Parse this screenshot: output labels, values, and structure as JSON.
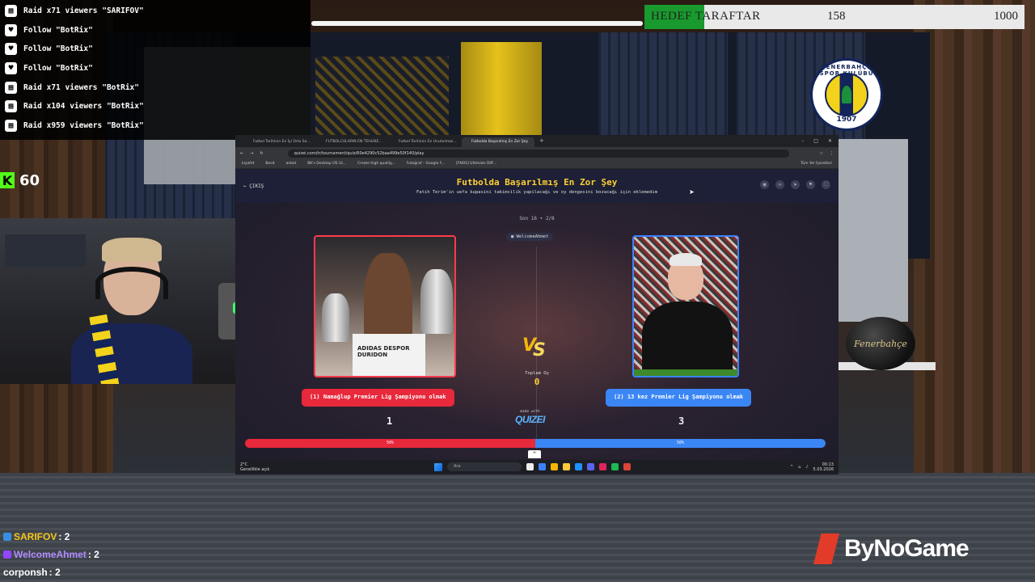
{
  "events": [
    {
      "icon": "raid-icon",
      "text": "Raid x71 viewers \"SARIFOV\""
    },
    {
      "icon": "heart-icon",
      "text": "Follow \"BotRix\""
    },
    {
      "icon": "heart-icon",
      "text": "Follow \"BotRix\""
    },
    {
      "icon": "heart-icon",
      "text": "Follow \"BotRix\""
    },
    {
      "icon": "raid-icon",
      "text": "Raid x71 viewers \"BotRix\""
    },
    {
      "icon": "raid-icon",
      "text": "Raid x104 viewers \"BotRix\""
    },
    {
      "icon": "raid-icon",
      "text": "Raid x959 viewers \"BotRix\""
    }
  ],
  "kick": {
    "logo": "K",
    "viewers": "60",
    "color": "#53fc18"
  },
  "goal": {
    "label": "HEDEF TARAFTAR",
    "current": "158",
    "target": "1000",
    "progress": 0.158,
    "fill_color": "#189a2e"
  },
  "club_badge": {
    "ring_text": "FENERBAHÇE SPOR KULÜBÜ",
    "year": "1907"
  },
  "ball_text": "Fenerbahçe",
  "chat": [
    {
      "name": "SARIFOV",
      "message": ": 2",
      "name_color": "#f5c518",
      "badge_color": "#3a8dde"
    },
    {
      "name": "WelcomeAhmet",
      "message": ": 2",
      "name_color": "#b18cff",
      "badge_color": "#9146ff"
    },
    {
      "name": "corponsh",
      "message": ": 2",
      "name_color": "#ffffff",
      "badge_color": ""
    }
  ],
  "brand": {
    "name": "ByNoGame",
    "color": "#e23b2a"
  },
  "browser": {
    "tabs": [
      {
        "label": "Futbol Tarihinin En İyi Orta Saha...",
        "active": false
      },
      {
        "label": "FUTBOLCULARIN EN TEHLİKELİ...",
        "active": false
      },
      {
        "label": "Futbol Tarihinin En Unutulmaz...",
        "active": false
      },
      {
        "label": "Futbolda Başarılmış En Zor Şey",
        "active": true
      }
    ],
    "url": "quizei.com/tr/tournament/quiz/60e4290c52baa499e50f140/play",
    "bookmarks": [
      "kiyafet",
      "Besit",
      "anket",
      "BK's Desktop OS UI...",
      "Create high quality...",
      "Fotoğraf – Google F...",
      "[FNOS] Ultimate Diff..."
    ],
    "bookmarks_right": "Tüm Yer İşaretleri"
  },
  "quiz": {
    "back_label": "ÇIKIŞ",
    "title": "Futbolda Başarılmış En Zor Şey",
    "subtitle": "Fatih Terim'in uefa kupasini takimcilik yapilacağı ve oy dengesini bozacağı için eklemedim",
    "round": "Son 16 • 2/8",
    "user": "WelcomeAhmet",
    "vs_label": "VS",
    "total_label": "Toplam Oy",
    "total_votes": "0",
    "options": [
      {
        "label": "(1) Namağlup Premier Lig Şampiyonu olmak",
        "votes": "1",
        "percent": "50%",
        "share": 0.5,
        "color": "#e8283b"
      },
      {
        "label": "(2) 13 kez Premier Lig Şampiyonu olmak",
        "votes": "3",
        "percent": "50%",
        "share": 0.5,
        "color": "#3b86f5"
      }
    ],
    "left_shorts_text": "ADIDAS DESPOR DURIDON",
    "made_with_label": "made with",
    "made_with_logo": "QUIZEI"
  },
  "taskbar": {
    "weather_temp": "2°C",
    "weather_text": "Genellikle açık",
    "search_placeholder": "Ara",
    "time": "00:13",
    "date": "5.03.2026"
  }
}
